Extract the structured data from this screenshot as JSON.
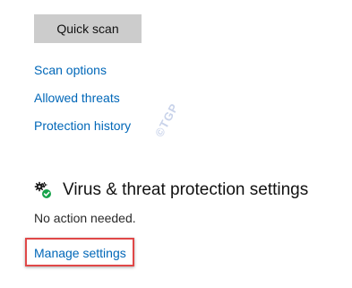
{
  "actions": {
    "quick_scan_label": "Quick scan"
  },
  "links": {
    "scan_options": "Scan options",
    "allowed_threats": "Allowed threats",
    "protection_history": "Protection history"
  },
  "watermark": {
    "text": "©TGP"
  },
  "settings_section": {
    "icon": "gear-check-icon",
    "title": "Virus & threat protection settings",
    "status": "No action needed.",
    "manage_link": "Manage settings"
  },
  "colors": {
    "link": "#0067b8",
    "button_bg": "#cccccc",
    "highlight_border": "#e04848",
    "check_green": "#16a34a"
  }
}
